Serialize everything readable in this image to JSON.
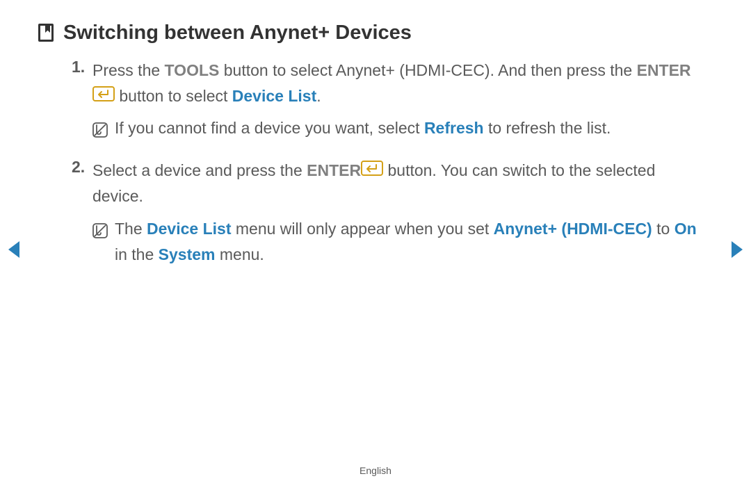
{
  "heading": "Switching between Anynet+ Devices",
  "step1": {
    "number": "1.",
    "t1": "Press the ",
    "tools": "TOOLS",
    "t2": " button to select Anynet+ (HDMI-CEC). And then press the ",
    "enter": "ENTER",
    "t3": " button to select ",
    "deviceList": "Device List",
    "t4": "."
  },
  "note1": {
    "t1": "If you cannot find a device you want, select ",
    "refresh": "Refresh",
    "t2": " to refresh the list."
  },
  "step2": {
    "number": "2.",
    "t1": "Select a device and press the ",
    "enter": "ENTER",
    "t2": " button. You can switch to the selected device."
  },
  "note2": {
    "t1": "The ",
    "deviceList": "Device List",
    "t2": " menu will only appear when you set ",
    "anynet": "Anynet+ (HDMI-CEC)",
    "t3": " to ",
    "on": "On",
    "t4": " in the ",
    "system": "System",
    "t5": " menu."
  },
  "footer": "English"
}
